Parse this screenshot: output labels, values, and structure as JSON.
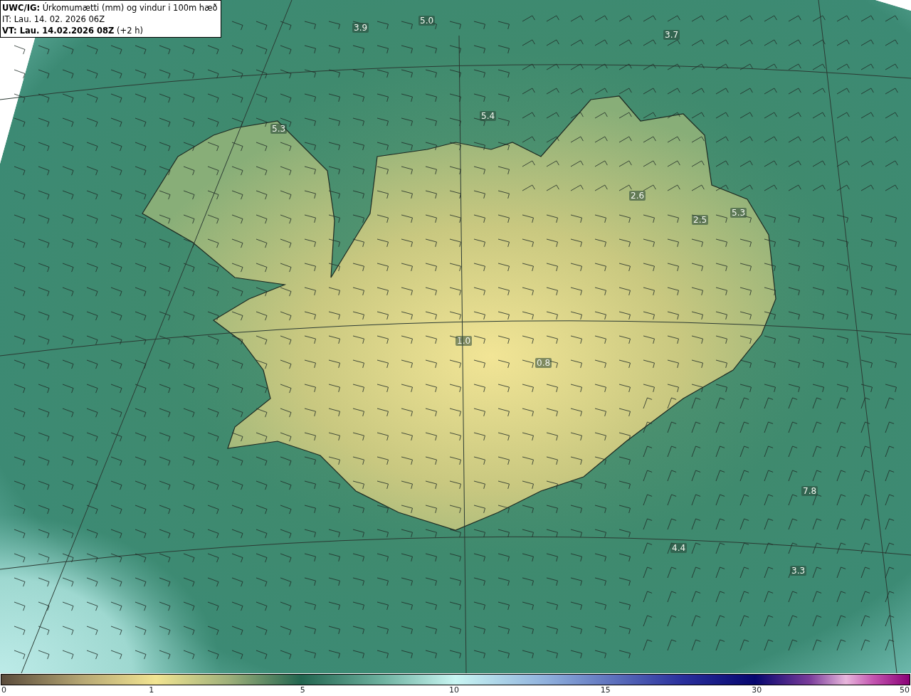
{
  "title_box": {
    "lines": [
      "**UWC/IG:** Úrkomumætti (mm) og vindur i 100m hæð",
      "IT: Lau. 14. 02. 2026 06Z",
      "**VT: Lau. 14.02.2026 08Z** (+2 h)"
    ]
  },
  "map": {
    "value_labels": [
      "3.9",
      "5.0",
      "3.7",
      "5.3",
      "5.4",
      "2.6",
      "2.5",
      "5.3",
      "1.0",
      "0.8",
      "7.8",
      "4.4",
      "3.3"
    ]
  },
  "colorbar": {
    "ticks": [
      "0",
      "1",
      "5",
      "10",
      "15",
      "30",
      "50"
    ]
  }
}
